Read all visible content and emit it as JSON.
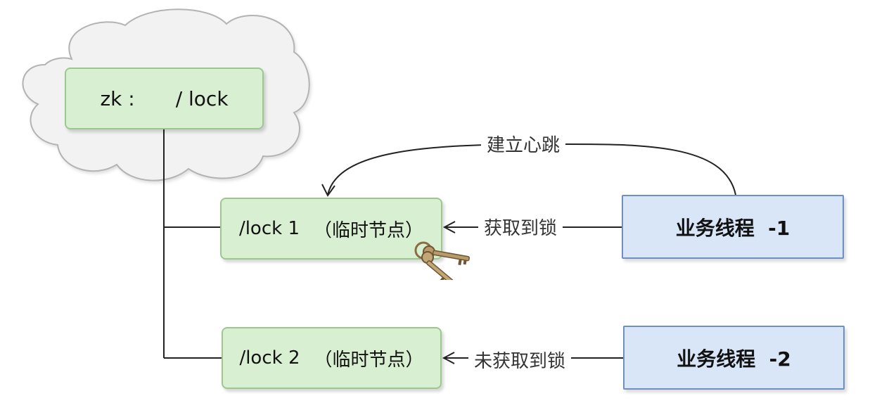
{
  "zk_node": {
    "prefix": "zk :",
    "path": "/ lock"
  },
  "lock_nodes": [
    {
      "name": "/lock 1",
      "type": "（临时节点）"
    },
    {
      "name": "/lock 2",
      "type": "（临时节点）"
    }
  ],
  "threads": [
    {
      "label": "业务线程  -1"
    },
    {
      "label": "业务线程  -2"
    }
  ],
  "edges": {
    "heartbeat": "建立心跳",
    "acquired": "获取到锁",
    "not_acquired": "未获取到锁"
  },
  "colors": {
    "cloud_fill": "#f2f2f2",
    "cloud_stroke": "#b3b3b3",
    "node_green_fill": "#d9efd2",
    "node_green_stroke": "#9bc98d",
    "node_blue_fill": "#d9e6f8",
    "node_blue_stroke": "#6d8fc4",
    "line": "#222222"
  },
  "icons": {
    "key": "key-icon",
    "cloud": "cloud-shape"
  }
}
